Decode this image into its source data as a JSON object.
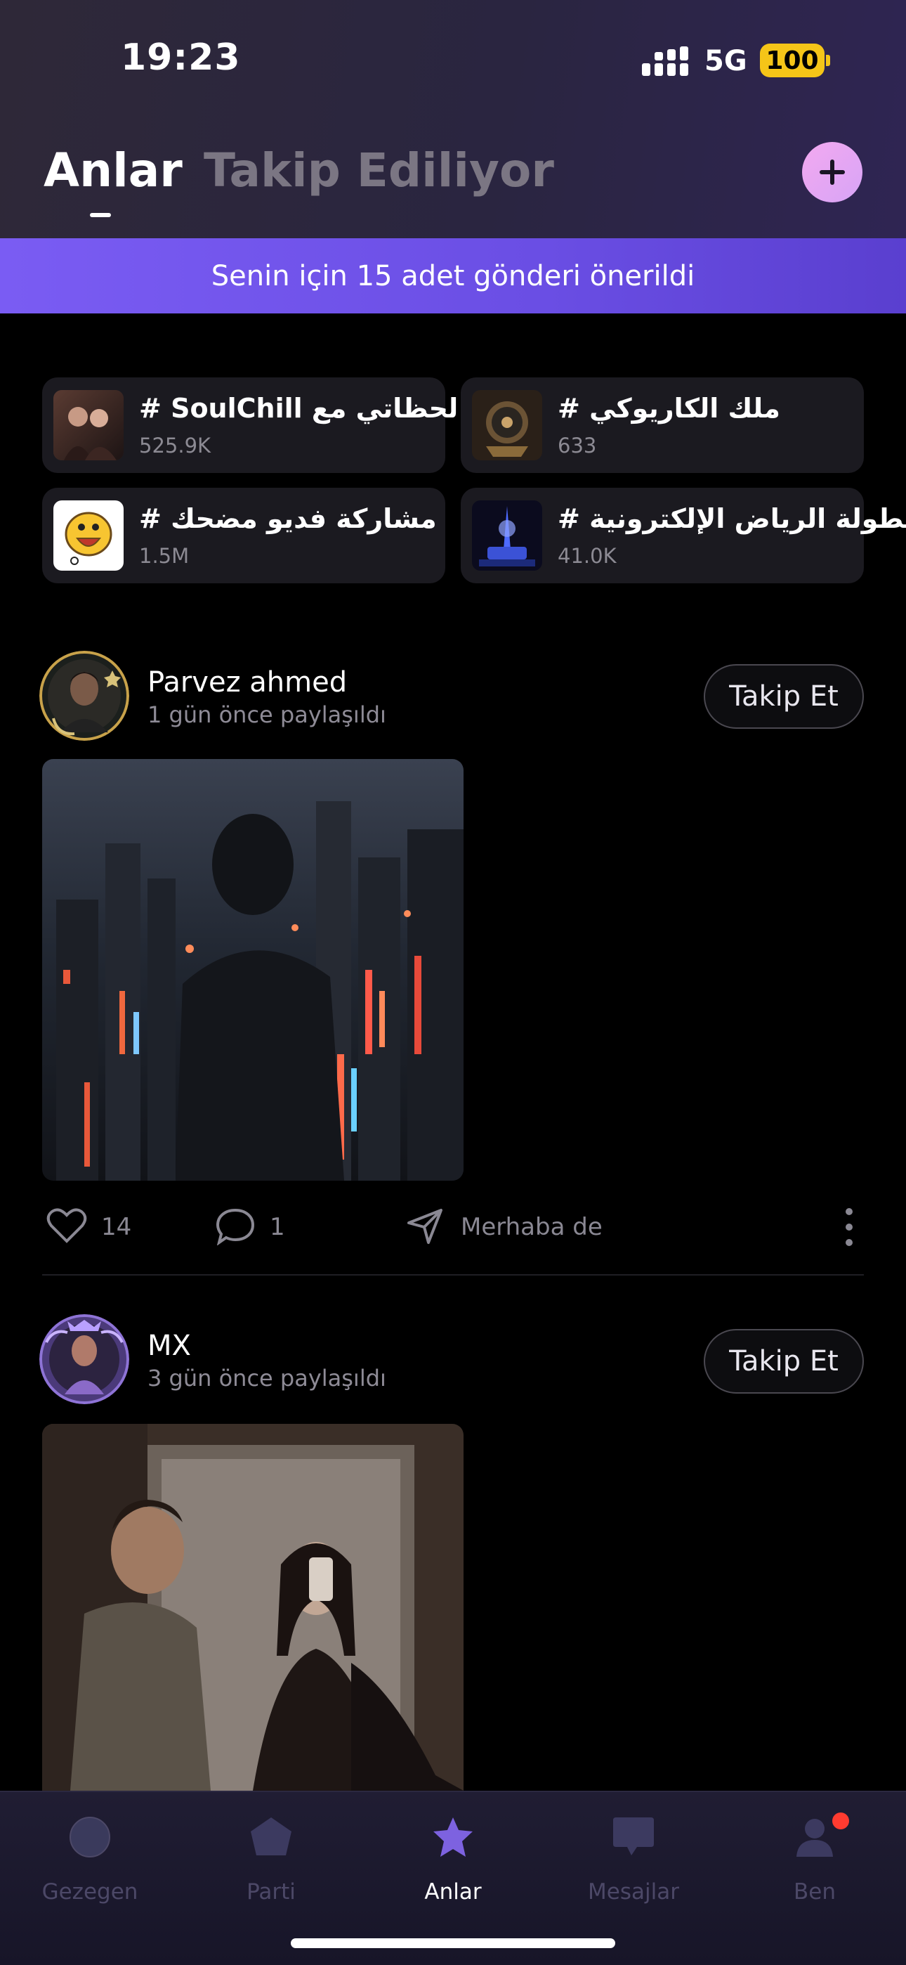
{
  "status_bar": {
    "time": "19:23",
    "network": "5G",
    "battery": "100"
  },
  "header": {
    "tab_active": "Anlar",
    "tab_following": "Takip Ediliyor"
  },
  "banner": {
    "text": "Senin için 15 adet gönderi önerildi"
  },
  "topics": [
    {
      "title": "# SoulChill لحظاتي مع",
      "count": "525.9K"
    },
    {
      "title": "# ملك الكاريوكي",
      "count": "633"
    },
    {
      "title": "# مشاركة فديو مضحك",
      "count": "1.5M"
    },
    {
      "title": "# بطولة الرياض الإلكترونية",
      "count": "41.0K"
    }
  ],
  "posts": [
    {
      "username": "Parvez ahmed",
      "time": "1 gün önce paylaşıldı",
      "follow_label": "Takip Et",
      "likes": "14",
      "comments": "1",
      "greet_label": "Merhaba de"
    },
    {
      "username": "MX",
      "time": "3 gün önce paylaşıldı",
      "follow_label": "Takip Et"
    }
  ],
  "nav": [
    {
      "label": "Gezegen",
      "icon": "planet-icon"
    },
    {
      "label": "Parti",
      "icon": "party-icon"
    },
    {
      "label": "Anlar",
      "icon": "star-icon",
      "active": true
    },
    {
      "label": "Mesajlar",
      "icon": "message-icon"
    },
    {
      "label": "Ben",
      "icon": "profile-icon",
      "badge": true
    }
  ],
  "colors": {
    "accent": "#7a5cf3",
    "battery": "#f5c518",
    "nav_inactive": "#4c4867",
    "badge": "#ff3b30"
  }
}
